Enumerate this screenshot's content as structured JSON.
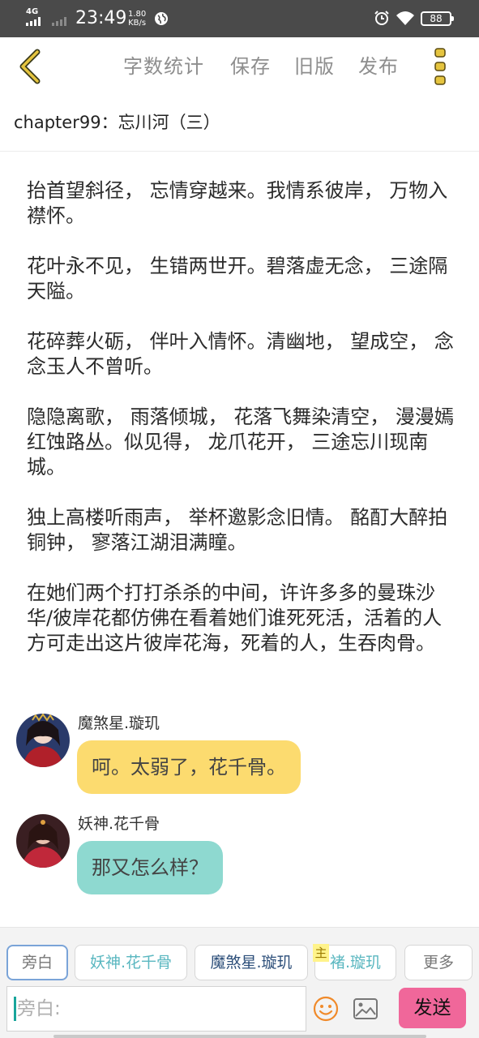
{
  "status_bar": {
    "network": "4G",
    "time": "23:49",
    "speed_value": "1.80",
    "speed_unit": "KB/s",
    "battery": "88",
    "icons": [
      "signal-icon",
      "globe-icon",
      "alarm-icon",
      "wifi-icon",
      "battery-icon"
    ]
  },
  "toolbar": {
    "word_count": "字数统计",
    "save": "保存",
    "old_version": "旧版",
    "publish": "发布",
    "back_icon": "chevron-left-icon",
    "more_icon": "vertical-dots-icon",
    "accent_color": "#e5c43f"
  },
  "chapter": {
    "title": "chapter99：忘川河（三）"
  },
  "paragraphs": [
    "抬首望斜径， 忘情穿越来。我情系彼岸， 万物入襟怀。",
    "花叶永不见， 生错两世开。碧落虚无念， 三途隔天隘。",
    "花碎葬火砺， 伴叶入情怀。清幽地， 望成空， 念念玉人不曾听。",
    "隐隐离歌， 雨落倾城， 花落飞舞染清空， 漫漫嫣红蚀路丛。似见得， 龙爪花开， 三途忘川现南城。",
    "独上高楼听雨声， 举杯邀影念旧情。 酩酊大醉拍铜钟， 寥落江湖泪满瞳。",
    "在她们两个打打杀杀的中间，许许多多的曼珠沙华/彼岸花都仿佛在看着她们谁死死活，活着的人方可走出这片彼岸花海，死着的人，生吞肉骨。"
  ],
  "messages": [
    {
      "name": "魔煞星.璇玑",
      "text": "呵。太弱了，花千骨。",
      "bubble_color": "#fcdb6f"
    },
    {
      "name": "妖神.花千骨",
      "text": "那又怎么样？",
      "bubble_color": "#8ed9d0"
    }
  ],
  "roles": {
    "narrator": "旁白",
    "hua": "妖神.花千骨",
    "xuanji": "魔煞星.璇玑",
    "main_badge": "主",
    "chu": "褚.璇玑",
    "more": "更多"
  },
  "composer": {
    "placeholder": "旁白:",
    "send": "发送",
    "send_color": "#f0679a",
    "emoji_icon": "smiley-icon",
    "image_icon": "image-icon"
  }
}
